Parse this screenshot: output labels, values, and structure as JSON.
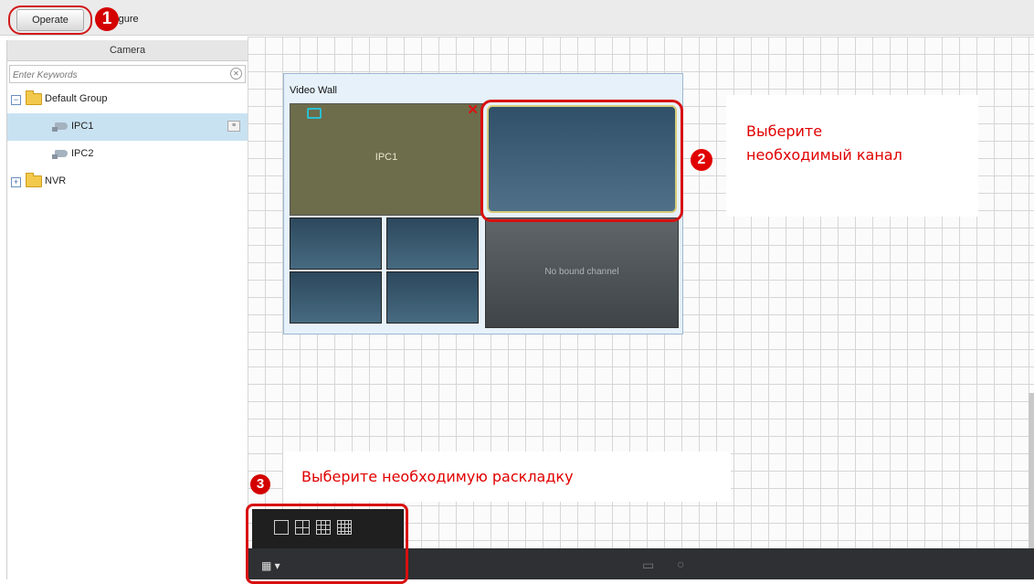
{
  "topbar": {
    "operate_label": "Operate",
    "configure_label": "nfigure"
  },
  "steps": {
    "one": "1",
    "two": "2",
    "three": "3"
  },
  "left_panel": {
    "header": "Camera",
    "search_placeholder": "Enter Keywords",
    "tree": {
      "default_group": {
        "label": "Default Group",
        "toggle": "−"
      },
      "ipc1": "IPC1",
      "ipc2": "IPC2",
      "nvr": {
        "label": "NVR",
        "toggle": "+"
      }
    }
  },
  "video_wall": {
    "title": "Video Wall",
    "screen_ipc1_label": "IPC1",
    "screen_nobind_label": "No bound channel"
  },
  "notes": {
    "select_channel_line1": "Выберите",
    "select_channel_line2": "необходимый канал",
    "select_layout": "Выберите необходимую раскладку"
  },
  "icons": {
    "close": "✕",
    "layout_toggle": "▦ ▾"
  },
  "colors": {
    "accent_red": "#d81010",
    "selection": "#c9e2f2"
  }
}
